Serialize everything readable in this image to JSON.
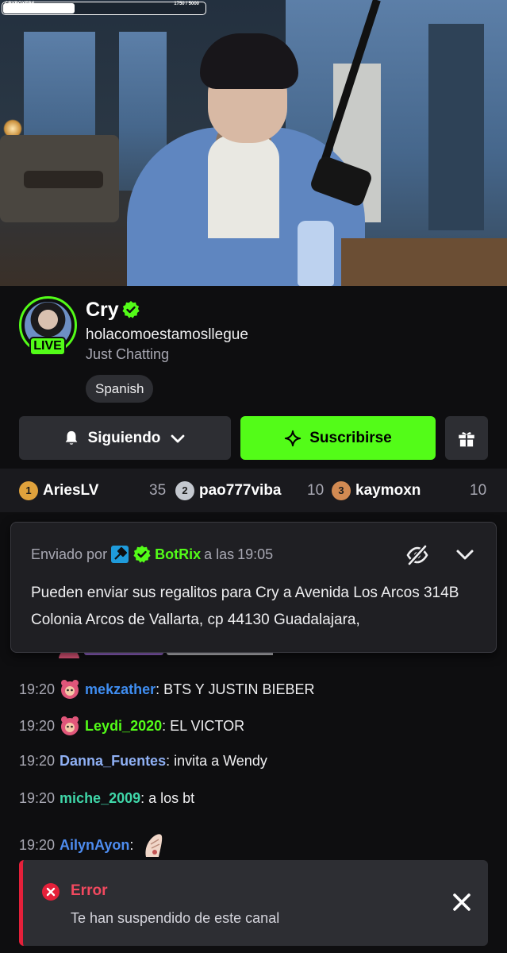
{
  "video": {
    "goal_label": "CRYBOYERS",
    "goal_count": "1750 / 5000",
    "goal_progress": 0.35
  },
  "channel": {
    "name": "Cry",
    "stream_title": "holacomoestamosllegue",
    "category": "Just Chatting",
    "live_label": "LIVE",
    "tag": "Spanish"
  },
  "actions": {
    "follow_label": "Siguiendo",
    "subscribe_label": "Suscribirse"
  },
  "leaderboard": [
    {
      "rank": "1",
      "name": "AriesLV",
      "count": "35",
      "medal_color": "#e0a23c"
    },
    {
      "rank": "2",
      "name": "pao777viba",
      "count": "10",
      "medal_color": "#c4c8cf"
    },
    {
      "rank": "3",
      "name": "kaymoxn",
      "count": "10",
      "medal_color": "#d28a52"
    }
  ],
  "pinned": {
    "prefix": "Enviado por",
    "sender": "BotRix",
    "time_prefix": "a las",
    "time": "19:05",
    "text": "Pueden enviar sus regalitos para Cry a Avenida Los Arcos 314B Colonia Arcos de Vallarta, cp 44130 Guadalajara,"
  },
  "chat": [
    {
      "time": "19:20",
      "user": "mekzather",
      "text": ": BTS Y JUSTIN BIEBER",
      "color": "#3f8df0",
      "badge": true
    },
    {
      "time": "19:20",
      "user": "Leydi_2020",
      "text": ": EL VICTOR",
      "color": "#53fc18",
      "badge": true
    },
    {
      "time": "19:20",
      "user": "Danna_Fuentes",
      "text": ": invita a Wendy",
      "color": "#8fb0f4",
      "badge": false
    },
    {
      "time": "19:20",
      "user": "miche_2009",
      "text": ": a los bt",
      "color": "#3fd6a8",
      "badge": false
    },
    {
      "time": "19:20",
      "user": "AilynAyon",
      "text": ":",
      "color": "#4d8cf0",
      "badge": false
    }
  ],
  "error": {
    "title": "Error",
    "message": "Te han suspendido de este canal"
  },
  "colors": {
    "accent": "#53fc18",
    "background": "#0e0e10",
    "error": "#e5203a"
  }
}
